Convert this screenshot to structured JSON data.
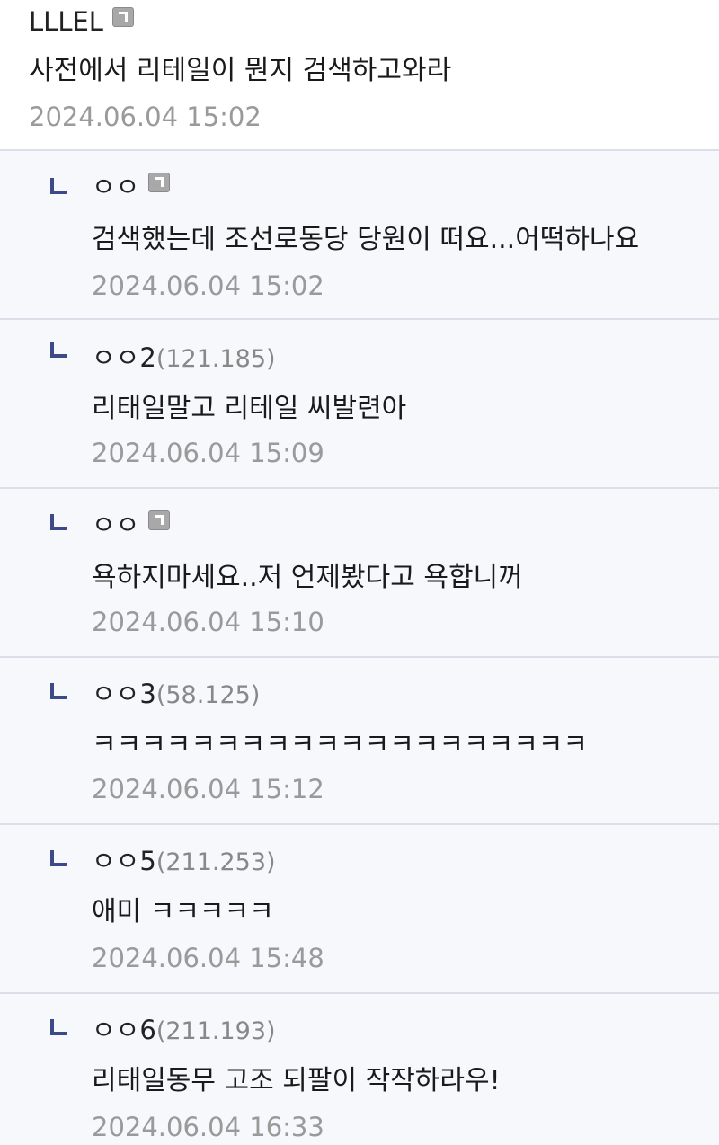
{
  "main": {
    "nickname": "LLLEL",
    "text": "사전에서 리테일이 뭔지 검색하고와라",
    "date": "2024.06.04 15:02"
  },
  "replies": [
    {
      "nickname": "ㅇㅇ",
      "ip": "",
      "fixed": true,
      "text": "검색했는데 조선로동당 당원이 떠요...어떡하나요",
      "date": "2024.06.04 15:02"
    },
    {
      "nickname": "ㅇㅇ2",
      "ip": "(121.185)",
      "fixed": false,
      "text": "리태일말고 리테일 씨발련아",
      "date": "2024.06.04 15:09"
    },
    {
      "nickname": "ㅇㅇ",
      "ip": "",
      "fixed": true,
      "text": "욕하지마세요..저 언제봤다고 욕합니꺼",
      "date": "2024.06.04 15:10"
    },
    {
      "nickname": "ㅇㅇ3",
      "ip": "(58.125)",
      "fixed": false,
      "text": "ㅋㅋㅋㅋㅋㅋㅋㅋㅋㅋㅋㅋㅋㅋㅋㅋㅋㅋㅋㅋ",
      "date": "2024.06.04 15:12"
    },
    {
      "nickname": "ㅇㅇ5",
      "ip": "(211.253)",
      "fixed": false,
      "text": "애미 ㅋㅋㅋㅋㅋ",
      "date": "2024.06.04 15:48"
    },
    {
      "nickname": "ㅇㅇ6",
      "ip": "(211.193)",
      "fixed": false,
      "text": "리태일동무 고조 되팔이 작작하라우!",
      "date": "2024.06.04 16:33"
    }
  ]
}
